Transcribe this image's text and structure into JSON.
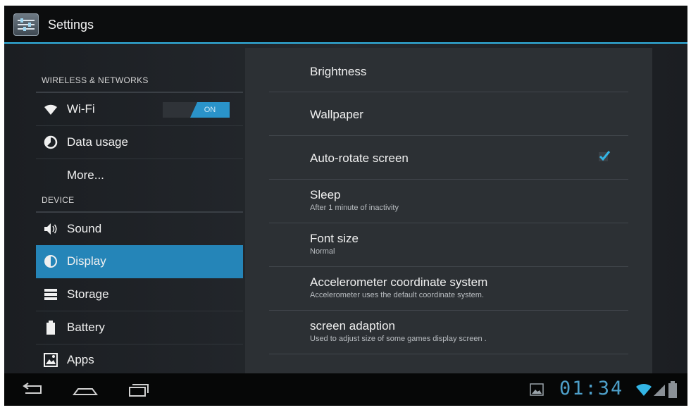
{
  "window": {
    "title": "Settings"
  },
  "sidebar": {
    "sections": [
      {
        "header": "WIRELESS & NETWORKS"
      },
      {
        "header": "DEVICE"
      }
    ],
    "items": [
      {
        "label": "Wi-Fi",
        "icon": "wifi-icon",
        "toggle": "ON"
      },
      {
        "label": "Data usage",
        "icon": "data-usage-icon"
      },
      {
        "label": "More..."
      },
      {
        "label": "Sound",
        "icon": "sound-icon"
      },
      {
        "label": "Display",
        "icon": "display-icon",
        "selected": true
      },
      {
        "label": "Storage",
        "icon": "storage-icon"
      },
      {
        "label": "Battery",
        "icon": "battery-icon"
      },
      {
        "label": "Apps",
        "icon": "apps-icon"
      }
    ]
  },
  "display_settings": [
    {
      "title": "Brightness"
    },
    {
      "title": "Wallpaper"
    },
    {
      "title": "Auto-rotate screen",
      "checked": true
    },
    {
      "title": "Sleep",
      "summary": "After 1 minute of inactivity"
    },
    {
      "title": "Font size",
      "summary": "Normal"
    },
    {
      "title": "Accelerometer coordinate system",
      "summary": "Accelerometer uses the default coordinate system."
    },
    {
      "title": "screen adaption",
      "summary": "Used to adjust size of some games display screen ."
    }
  ],
  "status_bar": {
    "time": "01:34"
  },
  "colors": {
    "accent": "#33b5e5",
    "selected": "#2585b8",
    "clock": "#4d9fc9"
  }
}
